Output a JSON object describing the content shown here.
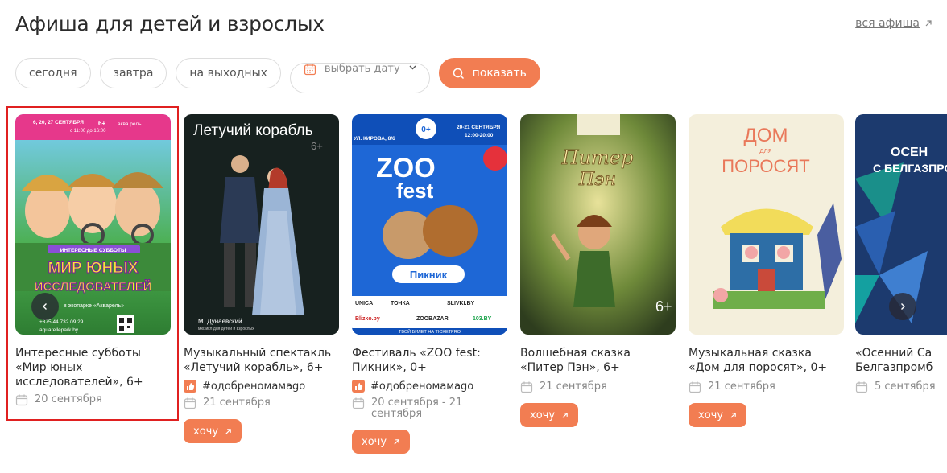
{
  "header": {
    "title": "Афиша для детей и взрослых",
    "all_link": "вся афиша"
  },
  "filters": {
    "today": "сегодня",
    "tomorrow": "завтра",
    "weekend": "на выходных",
    "pick_date": "выбрать дату",
    "show": "показать"
  },
  "cards": [
    {
      "title": "Интересные субботы «Мир юных исследователей», 6+",
      "date": "20 сентября"
    },
    {
      "title": "Музыкальный спектакль «Летучий корабль», 6+",
      "tag": "#одобреномамаgo",
      "date": "21 сентября",
      "want": "хочу"
    },
    {
      "title": "Фестиваль «ZOO fest: Пикник», 0+",
      "tag": "#одобреномамаgo",
      "date": "20 сентября - 21 сентября",
      "want": "хочу"
    },
    {
      "title": "Волшебная сказка «Питер Пэн», 6+",
      "date": "21 сентября",
      "want": "хочу"
    },
    {
      "title": "Музыкальная сказка «Дом для поросят», 0+",
      "date": "21 сентября",
      "want": "хочу"
    },
    {
      "title": "«Осенний Са Белгазпромб",
      "date": "5 сентября"
    }
  ],
  "posters": {
    "p1": {
      "top_line": "6, 20, 27 СЕНТЯБРЯ",
      "time": "с 11:00 до 16:00",
      "banner": "ИНТЕРЕСНЫЕ СУББОТЫ",
      "big1": "МИР ЮНЫХ",
      "big2": "ИССЛЕДОВАТЕЛЕЙ",
      "place": "в экопарке «Акварель»",
      "phone": "+375 44 732 09 29",
      "site": "aquarellepark.by",
      "age": "6+",
      "brand": "аква рель"
    },
    "p2": {
      "title": "Летучий корабль",
      "age": "6+",
      "author": "М. Дунаевский",
      "sub": "мюзикл для детей и взрослых"
    },
    "p3": {
      "dates": "20-21 СЕНТЯБРЯ",
      "time": "12:00-20:00",
      "address": "УЛ. КИРОВА, 8/6",
      "zoo": "ZOO",
      "fest": "fest",
      "picnic": "Пикник",
      "age": "0+",
      "ticket": "ТВОЙ БИЛЕТ НА TICKETPRO",
      "sponsors": [
        "UNICA",
        "ТОЧКА",
        "SLIVKI.BY",
        "Blizko.by",
        "ZOOBAZAR",
        "103.BY"
      ]
    },
    "p4": {
      "line1": "Питер",
      "line2": "Пэн",
      "age": "6+"
    },
    "p5": {
      "line1": "ДОМ",
      "mid": "для",
      "line2": "ПОРОСЯТ"
    },
    "p6": {
      "line1": "ОСЕН",
      "line2": "С БЕЛГАЗПРО"
    }
  },
  "colors": {
    "accent": "#f27d52",
    "selection": "#e02020"
  }
}
